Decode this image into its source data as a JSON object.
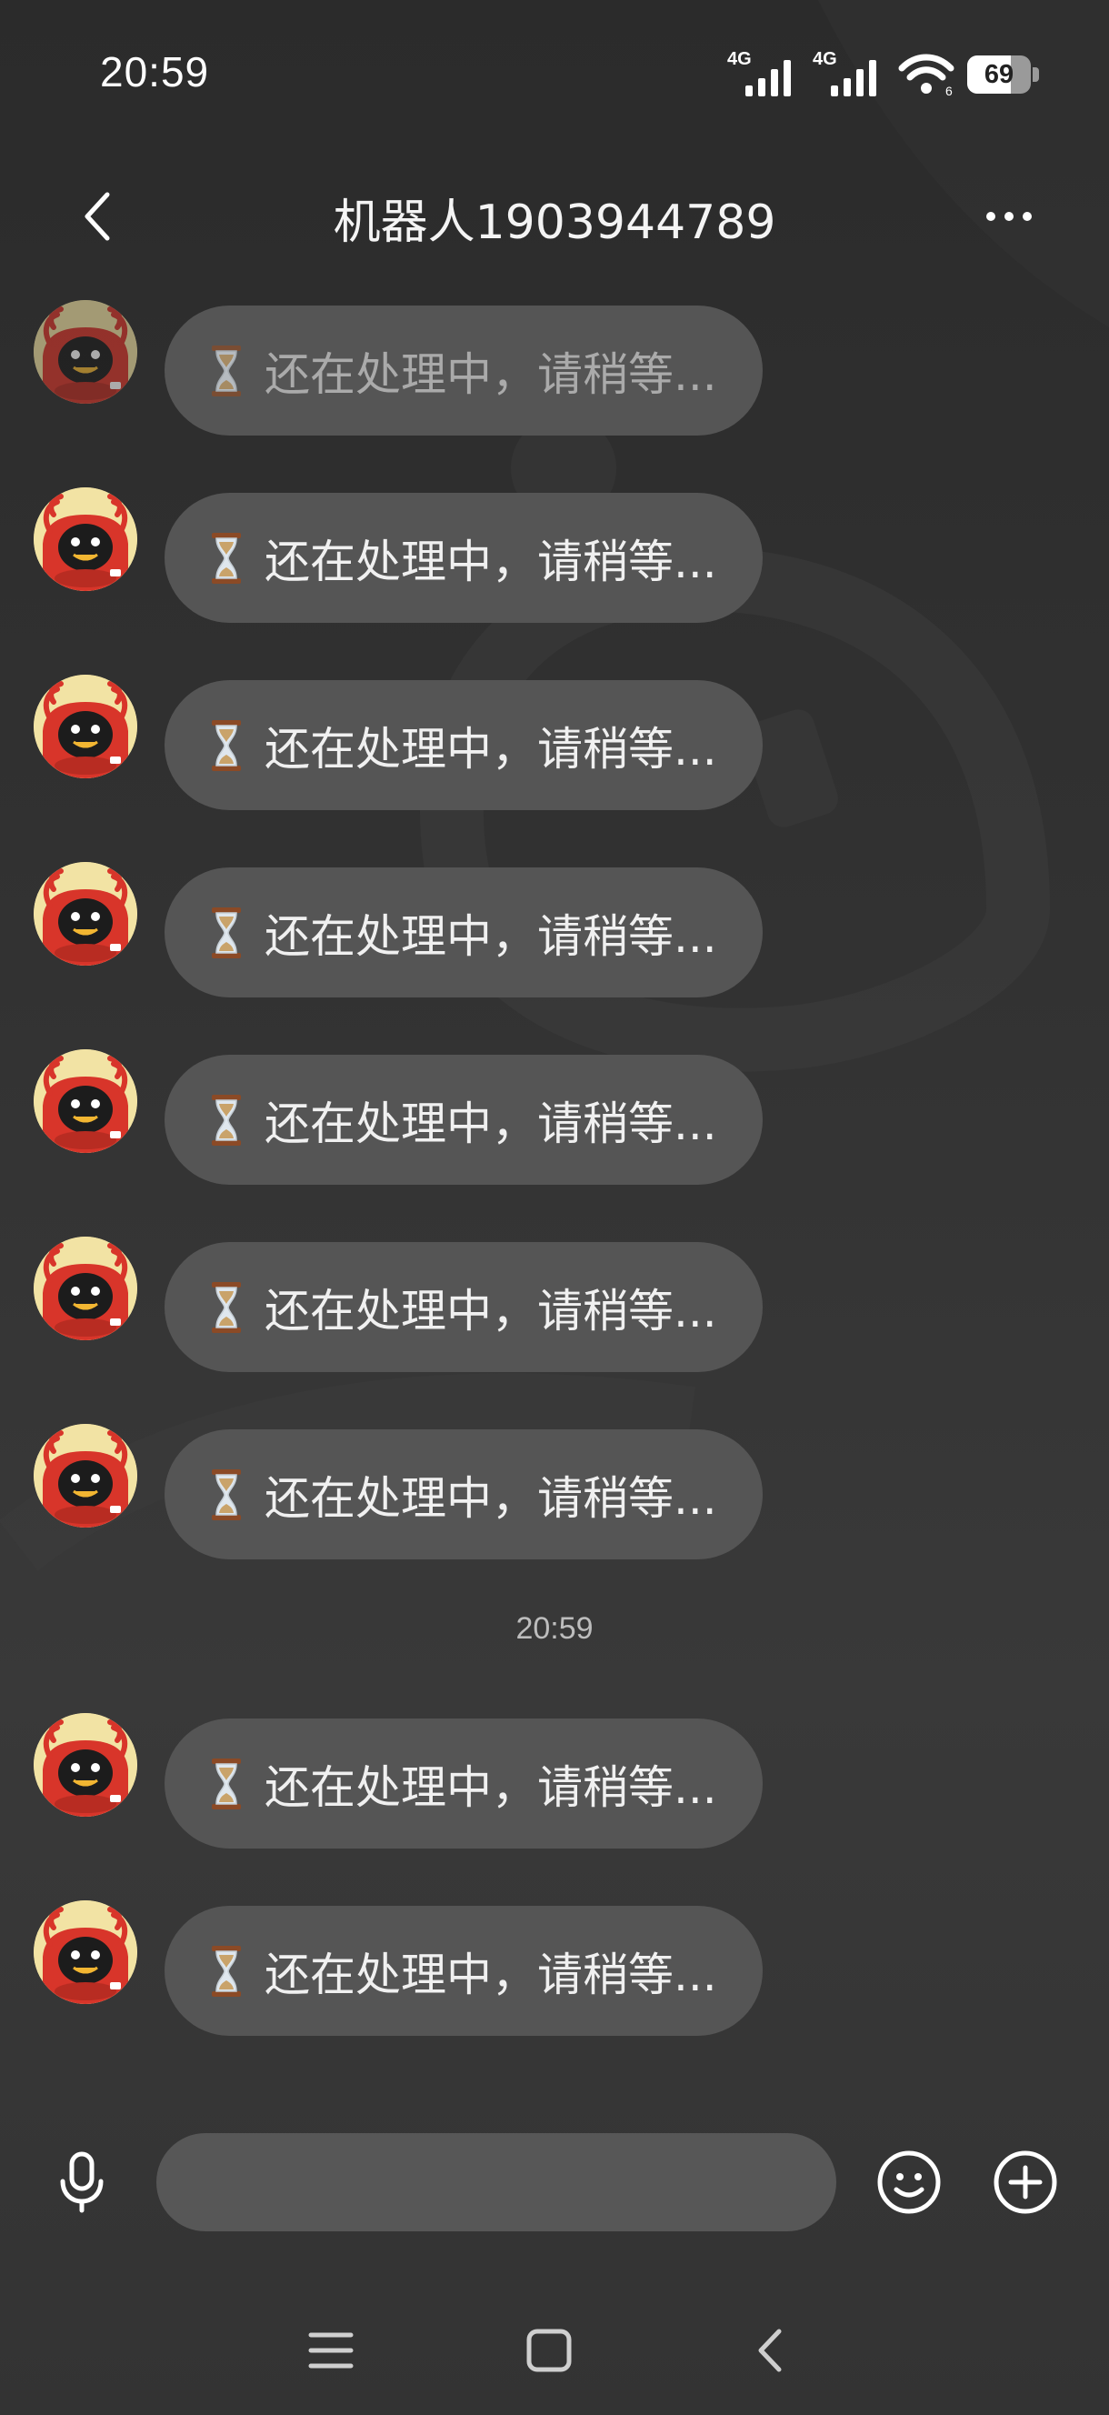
{
  "status_bar": {
    "time": "20:59",
    "sim1_network": "4G",
    "sim2_network": "4G",
    "battery_level": "69",
    "battery_fraction": 0.69,
    "icons": [
      "signal-icon",
      "signal-icon",
      "wifi-icon",
      "battery-icon"
    ]
  },
  "header": {
    "title": "机器人1903944789",
    "back_icon": "chevron-left-icon",
    "more_icon": "more-dots-icon"
  },
  "messages_before_divider": [
    {
      "text": "还在处理中，请稍等...",
      "icon": "hourglass-icon"
    },
    {
      "text": "还在处理中，请稍等...",
      "icon": "hourglass-icon"
    },
    {
      "text": "还在处理中，请稍等...",
      "icon": "hourglass-icon"
    },
    {
      "text": "还在处理中，请稍等...",
      "icon": "hourglass-icon"
    },
    {
      "text": "还在处理中，请稍等...",
      "icon": "hourglass-icon"
    },
    {
      "text": "还在处理中，请稍等...",
      "icon": "hourglass-icon"
    },
    {
      "text": "还在处理中，请稍等...",
      "icon": "hourglass-icon"
    }
  ],
  "time_divider": "20:59",
  "messages_after_divider": [
    {
      "text": "还在处理中，请稍等...",
      "icon": "hourglass-icon"
    },
    {
      "text": "还在处理中，请稍等...",
      "icon": "hourglass-icon"
    }
  ],
  "input_bar": {
    "value": "",
    "placeholder": "",
    "voice_icon": "microphone-icon",
    "emoji_icon": "smiley-icon",
    "plus_icon": "plus-circle-icon"
  },
  "nav_bar": {
    "icons": [
      "menu-icon",
      "home-square-icon",
      "back-chevron-icon"
    ]
  },
  "colors": {
    "background": "#2f2f2f",
    "bubble": "#555555",
    "input": "#575757",
    "text": "#f0f0f0",
    "avatar_bg": "#f2e3a4",
    "avatar_red": "#d8352a"
  }
}
